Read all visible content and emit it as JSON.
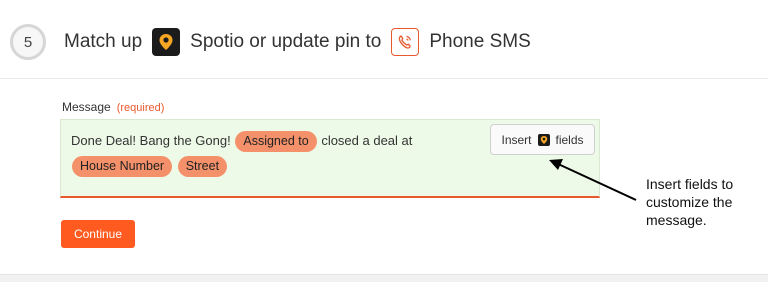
{
  "step": {
    "number": "5",
    "prefix": "Match up",
    "middle": "Spotio or update pin to",
    "target": "Phone SMS"
  },
  "icons": {
    "trigger_app": "spotio-pin-icon",
    "action_app": "phone-sms-icon",
    "insert_app": "spotio-pin-icon"
  },
  "colors": {
    "accent": "#e8592c",
    "pill": "#f4906a",
    "field_bg": "#eefae8",
    "continue": "#ff5a1f"
  },
  "field": {
    "label": "Message",
    "required": "(required)",
    "text_1": "Done Deal!  Bang the Gong!",
    "pill_1": "Assigned to",
    "text_2": "closed a deal at",
    "pill_2": "House Number",
    "pill_3": "Street"
  },
  "insert": {
    "before": "Insert",
    "after": "fields"
  },
  "continue_label": "Continue",
  "annotation": {
    "line_1": "Insert fields to",
    "line_2": "customize the",
    "line_3": "message."
  }
}
